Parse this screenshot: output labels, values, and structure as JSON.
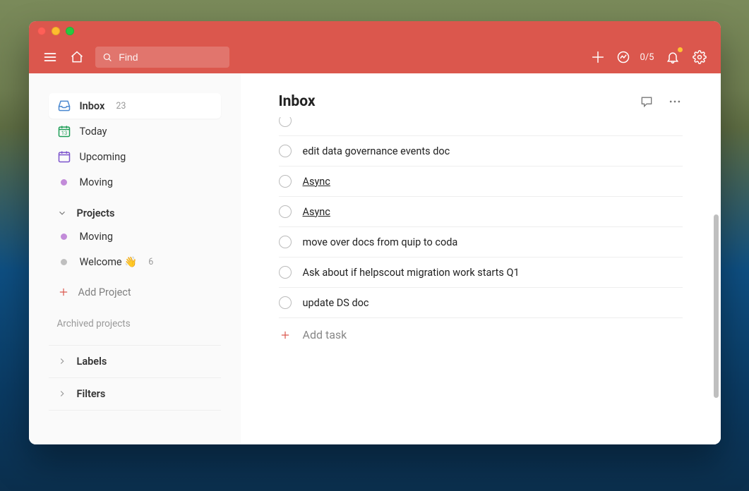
{
  "window": {
    "search_placeholder": "Find",
    "productivity_counter": "0/5"
  },
  "sidebar": {
    "nav": [
      {
        "key": "inbox",
        "label": "Inbox",
        "count": "23",
        "active": true
      },
      {
        "key": "today",
        "label": "Today",
        "count": "",
        "active": false
      },
      {
        "key": "upcoming",
        "label": "Upcoming",
        "count": "",
        "active": false
      }
    ],
    "favorites": [
      {
        "label": "Moving",
        "color": "#c28bd9"
      }
    ],
    "projects_header": "Projects",
    "projects": [
      {
        "label": "Moving",
        "color": "#c28bd9",
        "count": ""
      },
      {
        "label": "Welcome 👋",
        "color": "#bfbfbf",
        "count": "6"
      }
    ],
    "add_project_label": "Add Project",
    "archived_label": "Archived projects",
    "labels_header": "Labels",
    "filters_header": "Filters"
  },
  "main": {
    "title": "Inbox",
    "tasks": [
      {
        "label": "",
        "link": false,
        "truncated": true
      },
      {
        "label": "edit data governance events doc",
        "link": false
      },
      {
        "label": "Async",
        "link": true
      },
      {
        "label": "Async",
        "link": true
      },
      {
        "label": "move over docs from quip to coda",
        "link": false
      },
      {
        "label": "Ask about if helpscout migration work starts Q1",
        "link": false
      },
      {
        "label": "update DS doc",
        "link": false
      }
    ],
    "add_task_label": "Add task"
  }
}
